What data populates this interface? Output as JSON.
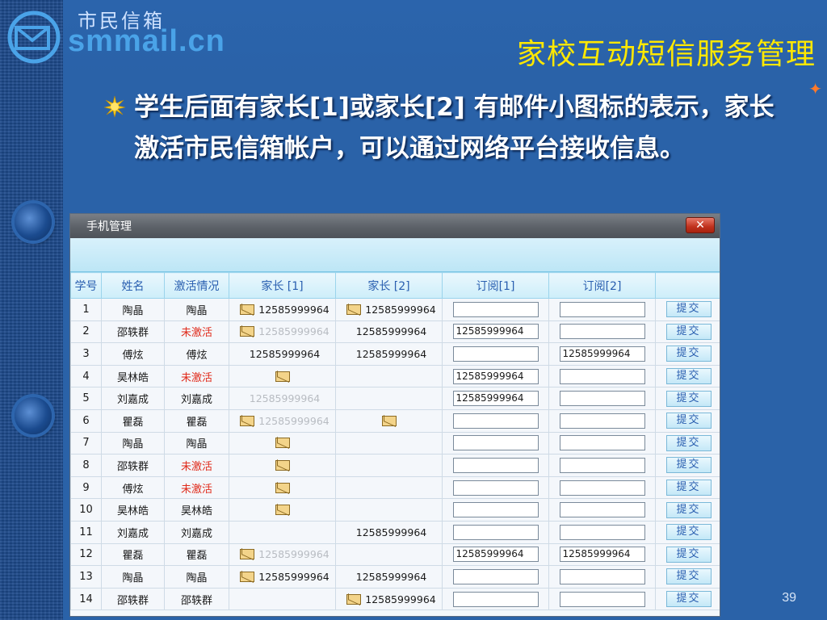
{
  "logo": {
    "cn": "市民信箱",
    "domain": "smmail.cn"
  },
  "slide": {
    "title": "家校互动短信服务管理",
    "bullet": "学生后面有家长[1]或家长[2] 有邮件小图标的表示，家长激活市民信箱帐户，可以通过网络平台接收信息。",
    "page_number": "39"
  },
  "window": {
    "title": "手机管理",
    "close_label": "✕"
  },
  "table": {
    "headers": [
      "学号",
      "姓名",
      "激活情况",
      "家长 [1]",
      "家长 [2]",
      "订阅[1]",
      "订阅[2]",
      ""
    ],
    "submit_label": "提交",
    "rows": [
      {
        "id": "1",
        "name": "陶晶",
        "status": "陶晶",
        "inactive": false,
        "p1": "12585999964",
        "p1_mail": true,
        "p1_gray": false,
        "p2": "12585999964",
        "p2_mail": true,
        "p2_gray": false,
        "s1": "",
        "s2": ""
      },
      {
        "id": "2",
        "name": "邵轶群",
        "status": "未激活",
        "inactive": true,
        "p1": "12585999964",
        "p1_mail": true,
        "p1_gray": true,
        "p2": "12585999964",
        "p2_mail": false,
        "p2_gray": false,
        "s1": "12585999964",
        "s2": ""
      },
      {
        "id": "3",
        "name": "傅炫",
        "status": "傅炫",
        "inactive": false,
        "p1": "12585999964",
        "p1_mail": false,
        "p1_gray": false,
        "p2": "12585999964",
        "p2_mail": false,
        "p2_gray": false,
        "s1": "",
        "s2": "12585999964"
      },
      {
        "id": "4",
        "name": "昊林皓",
        "status": "未激活",
        "inactive": true,
        "p1": "",
        "p1_mail": true,
        "p1_gray": false,
        "p2": "",
        "p2_mail": false,
        "p2_gray": false,
        "s1": "12585999964",
        "s2": ""
      },
      {
        "id": "5",
        "name": "刘嘉成",
        "status": "刘嘉成",
        "inactive": false,
        "p1": "12585999964",
        "p1_mail": false,
        "p1_gray": true,
        "p2": "",
        "p2_mail": false,
        "p2_gray": false,
        "s1": "12585999964",
        "s2": ""
      },
      {
        "id": "6",
        "name": "瞿磊",
        "status": "瞿磊",
        "inactive": false,
        "p1": "12585999964",
        "p1_mail": true,
        "p1_gray": true,
        "p2": "",
        "p2_mail": true,
        "p2_gray": false,
        "s1": "",
        "s2": ""
      },
      {
        "id": "7",
        "name": "陶晶",
        "status": "陶晶",
        "inactive": false,
        "p1": "",
        "p1_mail": true,
        "p1_gray": false,
        "p2": "",
        "p2_mail": false,
        "p2_gray": false,
        "s1": "",
        "s2": ""
      },
      {
        "id": "8",
        "name": "邵轶群",
        "status": "未激活",
        "inactive": true,
        "p1": "",
        "p1_mail": true,
        "p1_gray": false,
        "p2": "",
        "p2_mail": false,
        "p2_gray": false,
        "s1": "",
        "s2": ""
      },
      {
        "id": "9",
        "name": "傅炫",
        "status": "未激活",
        "inactive": true,
        "p1": "",
        "p1_mail": true,
        "p1_gray": false,
        "p2": "",
        "p2_mail": false,
        "p2_gray": false,
        "s1": "",
        "s2": ""
      },
      {
        "id": "10",
        "name": "昊林皓",
        "status": "昊林皓",
        "inactive": false,
        "p1": "",
        "p1_mail": true,
        "p1_gray": false,
        "p2": "",
        "p2_mail": false,
        "p2_gray": false,
        "s1": "",
        "s2": ""
      },
      {
        "id": "11",
        "name": "刘嘉成",
        "status": "刘嘉成",
        "inactive": false,
        "p1": "",
        "p1_mail": false,
        "p1_gray": false,
        "p2": "12585999964",
        "p2_mail": false,
        "p2_gray": false,
        "s1": "",
        "s2": ""
      },
      {
        "id": "12",
        "name": "瞿磊",
        "status": "瞿磊",
        "inactive": false,
        "p1": "12585999964",
        "p1_mail": true,
        "p1_gray": true,
        "p2": "",
        "p2_mail": false,
        "p2_gray": false,
        "s1": "12585999964",
        "s2": "12585999964"
      },
      {
        "id": "13",
        "name": "陶晶",
        "status": "陶晶",
        "inactive": false,
        "p1": "12585999964",
        "p1_mail": true,
        "p1_gray": false,
        "p2": "12585999964",
        "p2_mail": false,
        "p2_gray": false,
        "s1": "",
        "s2": ""
      },
      {
        "id": "14",
        "name": "邵轶群",
        "status": "邵轶群",
        "inactive": false,
        "p1": "",
        "p1_mail": false,
        "p1_gray": false,
        "p2": "12585999964",
        "p2_mail": true,
        "p2_gray": false,
        "s1": "",
        "s2": ""
      }
    ]
  }
}
